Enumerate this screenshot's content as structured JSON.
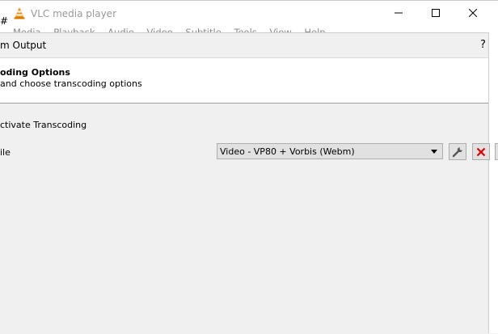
{
  "vlc": {
    "window_title": "VLC media player",
    "menu": [
      "Media",
      "Playback",
      "Audio",
      "Video",
      "Subtitle",
      "Tools",
      "View",
      "Help"
    ],
    "side_fragment": "#"
  },
  "dialog": {
    "title": "m Output",
    "help_label": "?",
    "header_title": "oding Options",
    "header_subtitle": " and choose transcoding options",
    "activate_label": "ctivate Transcoding",
    "profile_label": "ile",
    "profile_selected": "Video - VP80 + Vorbis (Webm)"
  },
  "colors": {
    "delete_icon": "#e00000",
    "cone_orange": "#f28c00"
  }
}
